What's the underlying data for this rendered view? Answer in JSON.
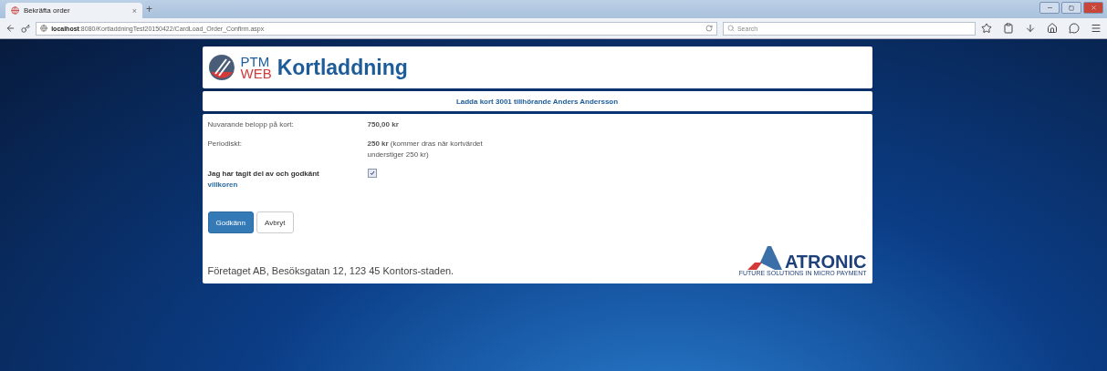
{
  "browser": {
    "tab_title": "Bekräfta order",
    "tab_close": "×",
    "new_tab": "+",
    "url_host": "localhost",
    "url_rest": ":8080/KortladdningTest20150422/CardLoad_Order_Confirm.aspx",
    "search_placeholder": "Search"
  },
  "header": {
    "logo_top": "PTM",
    "logo_bottom": "WEB",
    "title": "Kortladdning"
  },
  "banner": "Ladda kort 3001 tillhörande Anders Andersson",
  "details": [
    {
      "label": "Nuvarande belopp på kort:",
      "value": "**750,00 kr**"
    },
    {
      "label": "Periodiskt:",
      "value": "**250 kr** (kommer dras när kortvärdet understiger 250 kr)"
    }
  ],
  "terms": {
    "label": "Jag har tagit del av och godkänt",
    "link": "villkoren",
    "checked": true
  },
  "buttons": [
    {
      "label": "Godkänn",
      "kind": "primary"
    },
    {
      "label": "Avbryt",
      "kind": "default"
    }
  ],
  "footer": {
    "address": "Företaget AB, Besöksgatan 12, 123 45 Kontors-staden.",
    "brand": "ATRONIC",
    "tagline": "FUTURE SOLUTIONS IN MICRO PAYMENT"
  }
}
